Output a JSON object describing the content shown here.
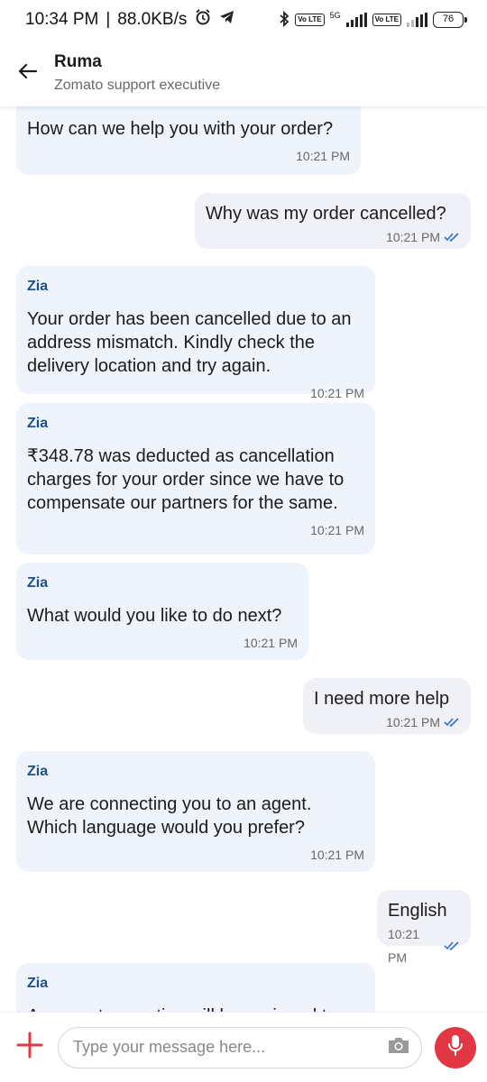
{
  "status_bar": {
    "time": "10:34 PM",
    "speed": "88.0KB/s",
    "network_5g": "5G",
    "volte_1": "Vo LTE",
    "volte_2": "Vo LTE",
    "battery": "76"
  },
  "header": {
    "name": "Ruma",
    "subtitle": "Zomato support executive"
  },
  "messages": [
    {
      "dir": "in",
      "sender": "",
      "text": "How can we help you with your order?",
      "time": "10:21 PM"
    },
    {
      "dir": "out",
      "text": "Why was my order cancelled?",
      "time": "10:21 PM"
    },
    {
      "dir": "in",
      "sender": "Zia",
      "text": "Your order has been cancelled due to an address mismatch. Kindly check the delivery location and try again.",
      "time": "10:21 PM"
    },
    {
      "dir": "in",
      "sender": "Zia",
      "text": "₹348.78 was deducted as cancellation charges for your order since we have to compensate our partners for the same.",
      "time": "10:21 PM"
    },
    {
      "dir": "in",
      "sender": "Zia",
      "text": "What would you like to do next?",
      "time": "10:21 PM"
    },
    {
      "dir": "out",
      "text": "I need more help",
      "time": "10:21 PM"
    },
    {
      "dir": "in",
      "sender": "Zia",
      "text": "We are connecting you to an agent. Which language would you prefer?",
      "time": "10:21 PM"
    },
    {
      "dir": "out",
      "text": "English",
      "time": "10:21 PM"
    },
    {
      "dir": "in",
      "sender": "Zia",
      "text": "A support executive will be assigned to",
      "time": ""
    }
  ],
  "composer": {
    "placeholder": "Type your message here..."
  },
  "colors": {
    "accent": "#e23744",
    "sender": "#1c4f8c",
    "tick": "#2f6fd1",
    "bubble_in": "#eef3fc",
    "bubble_out": "#f0f1f6"
  }
}
